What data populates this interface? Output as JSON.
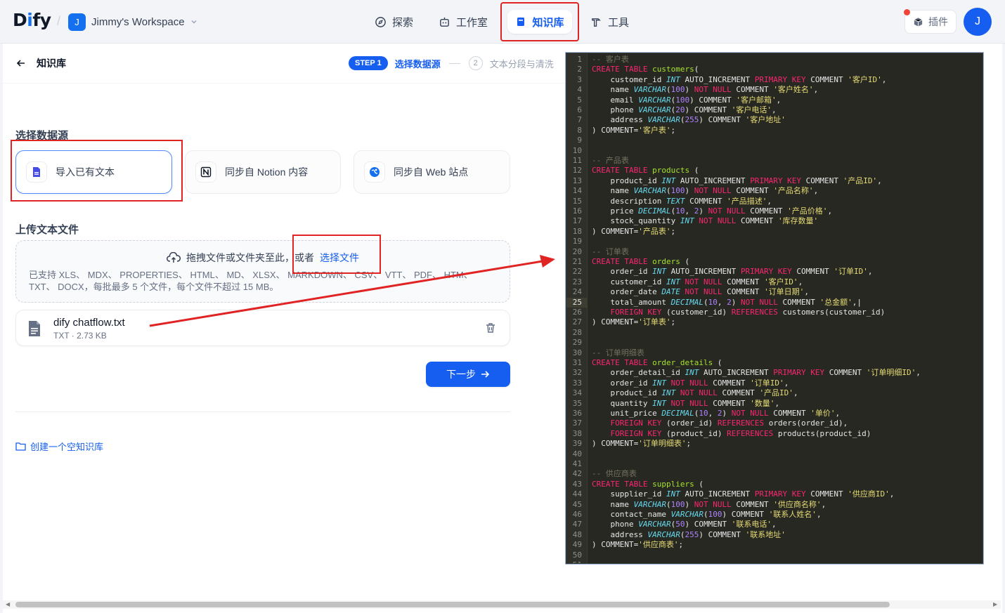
{
  "app": {
    "logo": "Dify",
    "workspace_initial": "J",
    "workspace_name": "Jimmy's Workspace",
    "user_initial": "J"
  },
  "nav": {
    "explore": "探索",
    "studio": "工作室",
    "knowledge": "知识库",
    "tools": "工具",
    "plugins": "插件"
  },
  "breadcrumb": {
    "title": "知识库"
  },
  "steps": {
    "step1_badge": "STEP 1",
    "step1_label": "选择数据源",
    "step2_num": "2",
    "step2_label": "文本分段与清洗"
  },
  "datasource": {
    "title": "选择数据源",
    "options": [
      {
        "label": "导入已有文本",
        "icon": "document-icon"
      },
      {
        "label": "同步自 Notion 内容",
        "icon": "notion-icon"
      },
      {
        "label": "同步自 Web 站点",
        "icon": "web-icon"
      }
    ]
  },
  "upload": {
    "title": "上传文本文件",
    "drag_text": "拖拽文件或文件夹至此，或者",
    "select_link": "选择文件",
    "supported": "已支持 XLS、 MDX、 PROPERTIES、 HTML、 MD、 XLSX、 MARKDOWN、 CSV、 VTT、 PDF、 HTM、 TXT、 DOCX，每批最多 5 个文件，每个文件不超过 15 MB。"
  },
  "file": {
    "name": "dify chatflow.txt",
    "meta": "TXT · 2.73 KB"
  },
  "actions": {
    "next": "下一步",
    "create_empty": "创建一个空知识库"
  },
  "colors": {
    "accent": "#155eef",
    "highlight_box": "#e02424",
    "editor_bg": "#272822"
  },
  "code": {
    "current_line": 25,
    "lines": [
      [
        [
          "cm",
          "-- 客户表"
        ]
      ],
      [
        [
          "kw",
          "CREATE TABLE "
        ],
        [
          "nm",
          "customers"
        ],
        [
          "",
          "("
        ]
      ],
      [
        [
          "",
          "    customer_id "
        ],
        [
          "ty",
          "INT"
        ],
        [
          "",
          " AUTO_INCREMENT "
        ],
        [
          "kw",
          "PRIMARY KEY"
        ],
        [
          "",
          " COMMENT "
        ],
        [
          "st",
          "'客户ID'"
        ],
        [
          "",
          ","
        ]
      ],
      [
        [
          "",
          "    name "
        ],
        [
          "ty",
          "VARCHAR"
        ],
        [
          "",
          "("
        ],
        [
          "num",
          "100"
        ],
        [
          "",
          ") "
        ],
        [
          "kw",
          "NOT NULL"
        ],
        [
          "",
          " COMMENT "
        ],
        [
          "st",
          "'客户姓名'"
        ],
        [
          "",
          ","
        ]
      ],
      [
        [
          "",
          "    email "
        ],
        [
          "ty",
          "VARCHAR"
        ],
        [
          "",
          "("
        ],
        [
          "num",
          "100"
        ],
        [
          "",
          ") COMMENT "
        ],
        [
          "st",
          "'客户邮箱'"
        ],
        [
          "",
          ","
        ]
      ],
      [
        [
          "",
          "    phone "
        ],
        [
          "ty",
          "VARCHAR"
        ],
        [
          "",
          "("
        ],
        [
          "num",
          "20"
        ],
        [
          "",
          ") COMMENT "
        ],
        [
          "st",
          "'客户电话'"
        ],
        [
          "",
          ","
        ]
      ],
      [
        [
          "",
          "    address "
        ],
        [
          "ty",
          "VARCHAR"
        ],
        [
          "",
          "("
        ],
        [
          "num",
          "255"
        ],
        [
          "",
          ") COMMENT "
        ],
        [
          "st",
          "'客户地址'"
        ]
      ],
      [
        [
          "",
          ") COMMENT="
        ],
        [
          "st",
          "'客户表'"
        ],
        [
          "",
          ";"
        ]
      ],
      [],
      [],
      [
        [
          "cm",
          "-- 产品表"
        ]
      ],
      [
        [
          "kw",
          "CREATE TABLE "
        ],
        [
          "nm",
          "products"
        ],
        [
          "",
          " ("
        ]
      ],
      [
        [
          "",
          "    product_id "
        ],
        [
          "ty",
          "INT"
        ],
        [
          "",
          " AUTO_INCREMENT "
        ],
        [
          "kw",
          "PRIMARY KEY"
        ],
        [
          "",
          " COMMENT "
        ],
        [
          "st",
          "'产品ID'"
        ],
        [
          "",
          ","
        ]
      ],
      [
        [
          "",
          "    name "
        ],
        [
          "ty",
          "VARCHAR"
        ],
        [
          "",
          "("
        ],
        [
          "num",
          "100"
        ],
        [
          "",
          ") "
        ],
        [
          "kw",
          "NOT NULL"
        ],
        [
          "",
          " COMMENT "
        ],
        [
          "st",
          "'产品名称'"
        ],
        [
          "",
          ","
        ]
      ],
      [
        [
          "",
          "    description "
        ],
        [
          "ty",
          "TEXT"
        ],
        [
          "",
          " COMMENT "
        ],
        [
          "st",
          "'产品描述'"
        ],
        [
          "",
          ","
        ]
      ],
      [
        [
          "",
          "    price "
        ],
        [
          "ty",
          "DECIMAL"
        ],
        [
          "",
          "("
        ],
        [
          "num",
          "10"
        ],
        [
          "",
          ", "
        ],
        [
          "num",
          "2"
        ],
        [
          "",
          ") "
        ],
        [
          "kw",
          "NOT NULL"
        ],
        [
          "",
          " COMMENT "
        ],
        [
          "st",
          "'产品价格'"
        ],
        [
          "",
          ","
        ]
      ],
      [
        [
          "",
          "    stock_quantity "
        ],
        [
          "ty",
          "INT"
        ],
        [
          "",
          " "
        ],
        [
          "kw",
          "NOT NULL"
        ],
        [
          "",
          " COMMENT "
        ],
        [
          "st",
          "'库存数量'"
        ]
      ],
      [
        [
          "",
          ") COMMENT="
        ],
        [
          "st",
          "'产品表'"
        ],
        [
          "",
          ";"
        ]
      ],
      [],
      [
        [
          "cm",
          "-- 订单表"
        ]
      ],
      [
        [
          "kw",
          "CREATE TABLE "
        ],
        [
          "nm",
          "orders"
        ],
        [
          "",
          " ("
        ]
      ],
      [
        [
          "",
          "    order_id "
        ],
        [
          "ty",
          "INT"
        ],
        [
          "",
          " AUTO_INCREMENT "
        ],
        [
          "kw",
          "PRIMARY KEY"
        ],
        [
          "",
          " COMMENT "
        ],
        [
          "st",
          "'订单ID'"
        ],
        [
          "",
          ","
        ]
      ],
      [
        [
          "",
          "    customer_id "
        ],
        [
          "ty",
          "INT"
        ],
        [
          "",
          " "
        ],
        [
          "kw",
          "NOT NULL"
        ],
        [
          "",
          " COMMENT "
        ],
        [
          "st",
          "'客户ID'"
        ],
        [
          "",
          ","
        ]
      ],
      [
        [
          "",
          "    order_date "
        ],
        [
          "ty",
          "DATE"
        ],
        [
          "",
          " "
        ],
        [
          "kw",
          "NOT NULL"
        ],
        [
          "",
          " COMMENT "
        ],
        [
          "st",
          "'订单日期'"
        ],
        [
          "",
          ","
        ]
      ],
      [
        [
          "",
          "    total_amount "
        ],
        [
          "ty",
          "DECIMAL"
        ],
        [
          "",
          "("
        ],
        [
          "num",
          "10"
        ],
        [
          "",
          ", "
        ],
        [
          "num",
          "2"
        ],
        [
          "",
          ") "
        ],
        [
          "kw",
          "NOT NULL"
        ],
        [
          "",
          " COMMENT "
        ],
        [
          "st",
          "'总金额'"
        ],
        [
          "",
          ",|"
        ]
      ],
      [
        [
          "",
          "    "
        ],
        [
          "kw",
          "FOREIGN KEY"
        ],
        [
          "",
          " (customer_id) "
        ],
        [
          "kw",
          "REFERENCES"
        ],
        [
          "",
          " customers(customer_id)"
        ]
      ],
      [
        [
          "",
          ") COMMENT="
        ],
        [
          "st",
          "'订单表'"
        ],
        [
          "",
          ";"
        ]
      ],
      [],
      [],
      [
        [
          "cm",
          "-- 订单明细表"
        ]
      ],
      [
        [
          "kw",
          "CREATE TABLE "
        ],
        [
          "nm",
          "order_details"
        ],
        [
          "",
          " ("
        ]
      ],
      [
        [
          "",
          "    order_detail_id "
        ],
        [
          "ty",
          "INT"
        ],
        [
          "",
          " AUTO_INCREMENT "
        ],
        [
          "kw",
          "PRIMARY KEY"
        ],
        [
          "",
          " COMMENT "
        ],
        [
          "st",
          "'订单明细ID'"
        ],
        [
          "",
          ","
        ]
      ],
      [
        [
          "",
          "    order_id "
        ],
        [
          "ty",
          "INT"
        ],
        [
          "",
          " "
        ],
        [
          "kw",
          "NOT NULL"
        ],
        [
          "",
          " COMMENT "
        ],
        [
          "st",
          "'订单ID'"
        ],
        [
          "",
          ","
        ]
      ],
      [
        [
          "",
          "    product_id "
        ],
        [
          "ty",
          "INT"
        ],
        [
          "",
          " "
        ],
        [
          "kw",
          "NOT NULL"
        ],
        [
          "",
          " COMMENT "
        ],
        [
          "st",
          "'产品ID'"
        ],
        [
          "",
          ","
        ]
      ],
      [
        [
          "",
          "    quantity "
        ],
        [
          "ty",
          "INT"
        ],
        [
          "",
          " "
        ],
        [
          "kw",
          "NOT NULL"
        ],
        [
          "",
          " COMMENT "
        ],
        [
          "st",
          "'数量'"
        ],
        [
          "",
          ","
        ]
      ],
      [
        [
          "",
          "    unit_price "
        ],
        [
          "ty",
          "DECIMAL"
        ],
        [
          "",
          "("
        ],
        [
          "num",
          "10"
        ],
        [
          "",
          ", "
        ],
        [
          "num",
          "2"
        ],
        [
          "",
          ") "
        ],
        [
          "kw",
          "NOT NULL"
        ],
        [
          "",
          " COMMENT "
        ],
        [
          "st",
          "'单价'"
        ],
        [
          "",
          ","
        ]
      ],
      [
        [
          "",
          "    "
        ],
        [
          "kw",
          "FOREIGN KEY"
        ],
        [
          "",
          " (order_id) "
        ],
        [
          "kw",
          "REFERENCES"
        ],
        [
          "",
          " orders(order_id),"
        ]
      ],
      [
        [
          "",
          "    "
        ],
        [
          "kw",
          "FOREIGN KEY"
        ],
        [
          "",
          " (product_id) "
        ],
        [
          "kw",
          "REFERENCES"
        ],
        [
          "",
          " products(product_id)"
        ]
      ],
      [
        [
          "",
          ") COMMENT="
        ],
        [
          "st",
          "'订单明细表'"
        ],
        [
          "",
          ";"
        ]
      ],
      [],
      [],
      [
        [
          "cm",
          "-- 供应商表"
        ]
      ],
      [
        [
          "kw",
          "CREATE TABLE "
        ],
        [
          "nm",
          "suppliers"
        ],
        [
          "",
          " ("
        ]
      ],
      [
        [
          "",
          "    supplier_id "
        ],
        [
          "ty",
          "INT"
        ],
        [
          "",
          " AUTO_INCREMENT "
        ],
        [
          "kw",
          "PRIMARY KEY"
        ],
        [
          "",
          " COMMENT "
        ],
        [
          "st",
          "'供应商ID'"
        ],
        [
          "",
          ","
        ]
      ],
      [
        [
          "",
          "    name "
        ],
        [
          "ty",
          "VARCHAR"
        ],
        [
          "",
          "("
        ],
        [
          "num",
          "100"
        ],
        [
          "",
          ") "
        ],
        [
          "kw",
          "NOT NULL"
        ],
        [
          "",
          " COMMENT "
        ],
        [
          "st",
          "'供应商名称'"
        ],
        [
          "",
          ","
        ]
      ],
      [
        [
          "",
          "    contact_name "
        ],
        [
          "ty",
          "VARCHAR"
        ],
        [
          "",
          "("
        ],
        [
          "num",
          "100"
        ],
        [
          "",
          ") COMMENT "
        ],
        [
          "st",
          "'联系人姓名'"
        ],
        [
          "",
          ","
        ]
      ],
      [
        [
          "",
          "    phone "
        ],
        [
          "ty",
          "VARCHAR"
        ],
        [
          "",
          "("
        ],
        [
          "num",
          "50"
        ],
        [
          "",
          ") COMMENT "
        ],
        [
          "st",
          "'联系电话'"
        ],
        [
          "",
          ","
        ]
      ],
      [
        [
          "",
          "    address "
        ],
        [
          "ty",
          "VARCHAR"
        ],
        [
          "",
          "("
        ],
        [
          "num",
          "255"
        ],
        [
          "",
          ") COMMENT "
        ],
        [
          "st",
          "'联系地址'"
        ]
      ],
      [
        [
          "",
          ") COMMENT="
        ],
        [
          "st",
          "'供应商表'"
        ],
        [
          "",
          ";"
        ]
      ],
      [],
      []
    ]
  }
}
